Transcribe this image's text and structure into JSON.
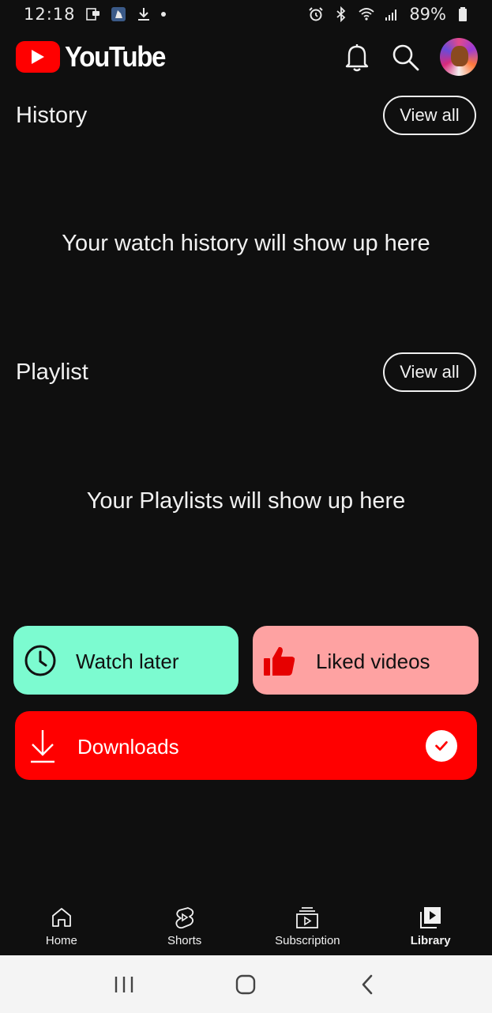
{
  "status_bar": {
    "time": "12:18",
    "battery": "89%"
  },
  "header": {
    "logo_text": "YouTube",
    "brand_color": "#ff0000"
  },
  "history": {
    "title": "History",
    "view_all": "View all",
    "empty_message": "Your watch history will show up here"
  },
  "playlist": {
    "title": "Playlist",
    "view_all": "View all",
    "empty_message": "Your Playlists will show up here"
  },
  "tiles": {
    "watch_later": {
      "label": "Watch later",
      "color": "#7cfbd0",
      "icon": "clock-icon"
    },
    "liked_videos": {
      "label": "Liked videos",
      "color": "#fea2a2",
      "icon": "thumbs-up-icon"
    },
    "downloads": {
      "label": "Downloads",
      "color": "#ff0000",
      "icon": "download-icon"
    }
  },
  "bottom_nav": {
    "items": [
      {
        "label": "Home",
        "icon": "home-icon"
      },
      {
        "label": "Shorts",
        "icon": "shorts-icon"
      },
      {
        "label": "Subscription",
        "icon": "subscriptions-icon"
      },
      {
        "label": "Library",
        "icon": "library-icon",
        "active": true
      }
    ]
  }
}
